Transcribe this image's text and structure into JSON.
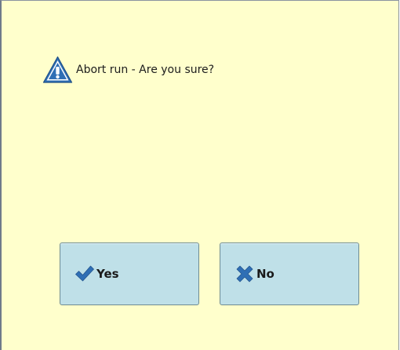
{
  "dialog": {
    "message": "Abort run - Are you sure?",
    "icon": "warning-icon",
    "background": "#ffffcc"
  },
  "buttons": {
    "yes": {
      "label": "Yes",
      "icon": "checkmark-icon",
      "icon_color": "#2f6fb5"
    },
    "no": {
      "label": "No",
      "icon": "close-icon",
      "icon_color": "#2f6fb5"
    },
    "background": "#bfe0e8"
  }
}
